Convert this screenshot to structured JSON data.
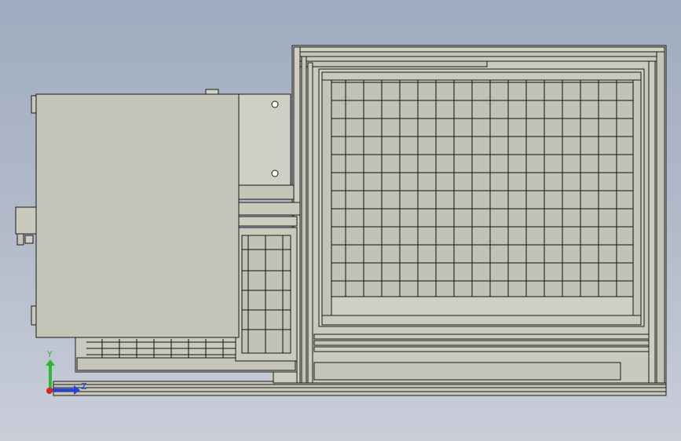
{
  "viewport": {
    "background_top": "#9fabbf",
    "background_bottom": "#c9ced9",
    "model_face_color": "#c4c4b8",
    "model_edge_color": "#000000"
  },
  "triad": {
    "y_label": "Y",
    "z_label": "Z",
    "y_color": "#2fb82f",
    "z_color": "#2244dd",
    "x_color": "#dd2222"
  }
}
